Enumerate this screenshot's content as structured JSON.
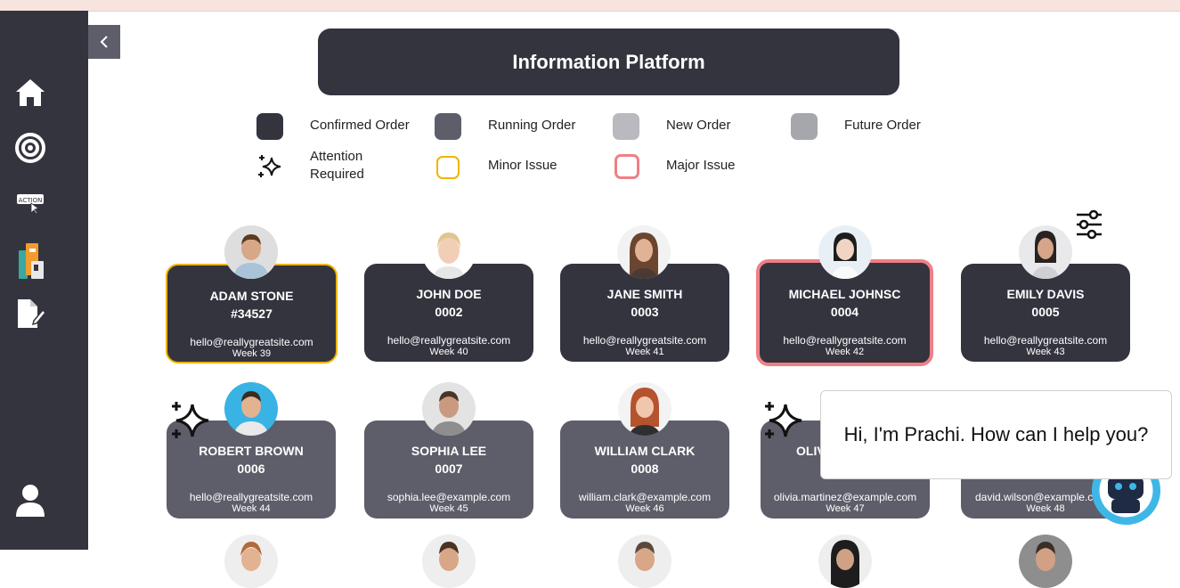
{
  "app_title": "Information Platform",
  "legend": [
    {
      "label": "Confirmed Order",
      "color": "#34343f"
    },
    {
      "label": "Running Order",
      "color": "#5d5e6a"
    },
    {
      "label": "New Order",
      "color": "#b9b9bf"
    },
    {
      "label": "Future Order",
      "color": "#a6a6ad"
    },
    {
      "label": "Attention Required",
      "icon": "sparkle-icon"
    },
    {
      "label": "Minor Issue",
      "color": "#f0b400"
    },
    {
      "label": "Major Issue",
      "color": "#ef7f86"
    }
  ],
  "sidebar": {
    "items": [
      {
        "icon": "home-icon"
      },
      {
        "icon": "target-icon"
      },
      {
        "icon": "action-icon",
        "label": "ACTION"
      },
      {
        "icon": "books-icon"
      },
      {
        "icon": "edit-document-icon"
      }
    ],
    "profile_icon": "user-icon"
  },
  "cards_row1": [
    {
      "name": "ADAM STONE",
      "number": "#34527",
      "email": "hello@reallygreatsite.com",
      "week": "Week 39",
      "status": "minor"
    },
    {
      "name": "JOHN DOE",
      "number": "0002",
      "email": "hello@reallygreatsite.com",
      "week": "Week 40",
      "status": "none"
    },
    {
      "name": "JANE SMITH",
      "number": "0003",
      "email": "hello@reallygreatsite.com",
      "week": "Week 41",
      "status": "none"
    },
    {
      "name": "MICHAEL JOHNSC",
      "number": "0004",
      "email": "hello@reallygreatsite.com",
      "week": "Week 42",
      "status": "major"
    },
    {
      "name": "EMILY DAVIS",
      "number": "0005",
      "email": "hello@reallygreatsite.com",
      "week": "Week 43",
      "status": "none"
    }
  ],
  "cards_row2": [
    {
      "name": "ROBERT BROWN",
      "number": "0006",
      "email": "hello@reallygreatsite.com",
      "week": "Week 44",
      "attention": true
    },
    {
      "name": "SOPHIA LEE",
      "number": "0007",
      "email": "sophia.lee@example.com",
      "week": "Week 45"
    },
    {
      "name": "WILLIAM CLARK",
      "number": "0008",
      "email": "william.clark@example.com",
      "week": "Week 46"
    },
    {
      "name": "OLIV",
      "number": "",
      "email": "olivia.martinez@example.com",
      "week": "Week 47",
      "attention": true
    },
    {
      "name": "",
      "number": "",
      "email": "david.wilson@example.com",
      "week": "Week 48"
    }
  ],
  "chat": {
    "message": "Hi, I'm Prachi. How can I help you?"
  }
}
